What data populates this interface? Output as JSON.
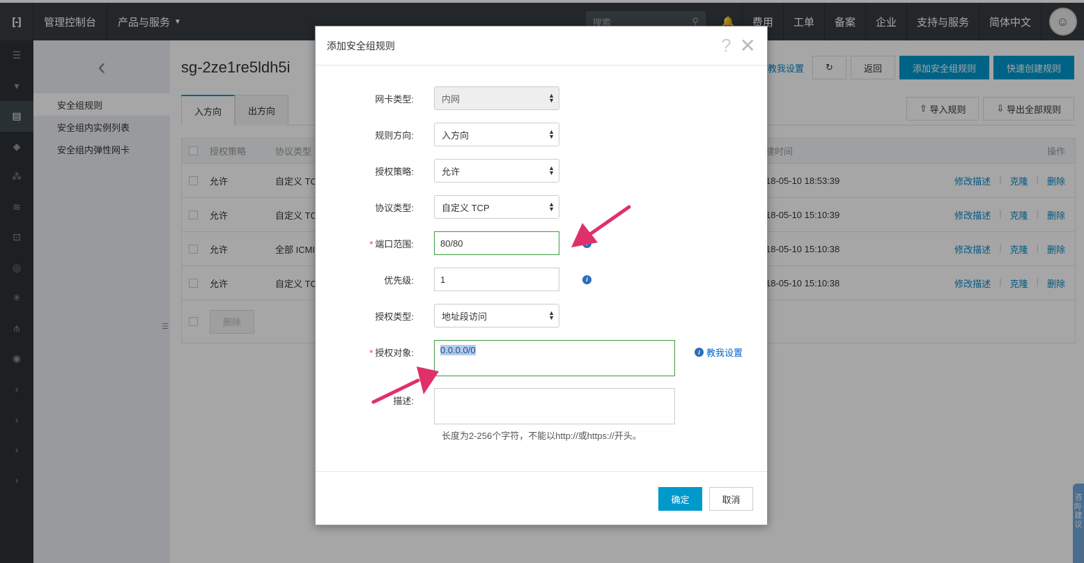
{
  "topbar": {
    "console": "管理控制台",
    "products": "产品与服务",
    "search_placeholder": "搜索",
    "links": [
      "费用",
      "工单",
      "备案",
      "企业",
      "支持与服务",
      "简体中文"
    ]
  },
  "subnav": {
    "items": [
      "安全组规则",
      "安全组内实例列表",
      "安全组内弹性网卡"
    ]
  },
  "main": {
    "title": "sg-2ze1re5ldh5i",
    "teach_link": "教我设置",
    "back_label": "返回",
    "add_rule_label": "添加安全组规则",
    "quick_create_label": "快速创建规则",
    "tabs": [
      "入方向",
      "出方向"
    ],
    "import_label": "导入规则",
    "export_label": "导出全部规则",
    "columns": [
      "授权策略",
      "协议类型",
      "建时间",
      "操作"
    ],
    "rows": [
      {
        "policy": "允许",
        "proto": "自定义 TC",
        "time": "18-05-10 18:53:39"
      },
      {
        "policy": "允许",
        "proto": "自定义 TC",
        "time": "18-05-10 15:10:39"
      },
      {
        "policy": "允许",
        "proto": "全部 ICMI",
        "time": "18-05-10 15:10:38"
      },
      {
        "policy": "允许",
        "proto": "自定义 TC",
        "time": "18-05-10 15:10:38"
      }
    ],
    "row_actions": [
      "修改描述",
      "克隆",
      "删除"
    ],
    "bulk_delete": "删除"
  },
  "dialog": {
    "title": "添加安全组规则",
    "fields": {
      "nic_type": {
        "label": "网卡类型:",
        "value": "内网"
      },
      "direction": {
        "label": "规则方向:",
        "value": "入方向"
      },
      "policy": {
        "label": "授权策略:",
        "value": "允许"
      },
      "protocol": {
        "label": "协议类型:",
        "value": "自定义 TCP"
      },
      "port_range": {
        "label": "端口范围:",
        "value": "80/80"
      },
      "priority": {
        "label": "优先级:",
        "value": "1"
      },
      "auth_type": {
        "label": "授权类型:",
        "value": "地址段访问"
      },
      "auth_object": {
        "label": "授权对象:",
        "value": "0.0.0.0/0"
      },
      "description": {
        "label": "描述:",
        "value": ""
      }
    },
    "teach_label": "教我设置",
    "hint": "长度为2-256个字符，不能以http://或https://开头。",
    "ok_label": "确定",
    "cancel_label": "取消"
  },
  "side_float": "咨询·建议",
  "colors": {
    "accent": "#0099cc",
    "topbar": "#373d41",
    "arrow": "#e0306a",
    "valid": "#3c9a3c"
  }
}
